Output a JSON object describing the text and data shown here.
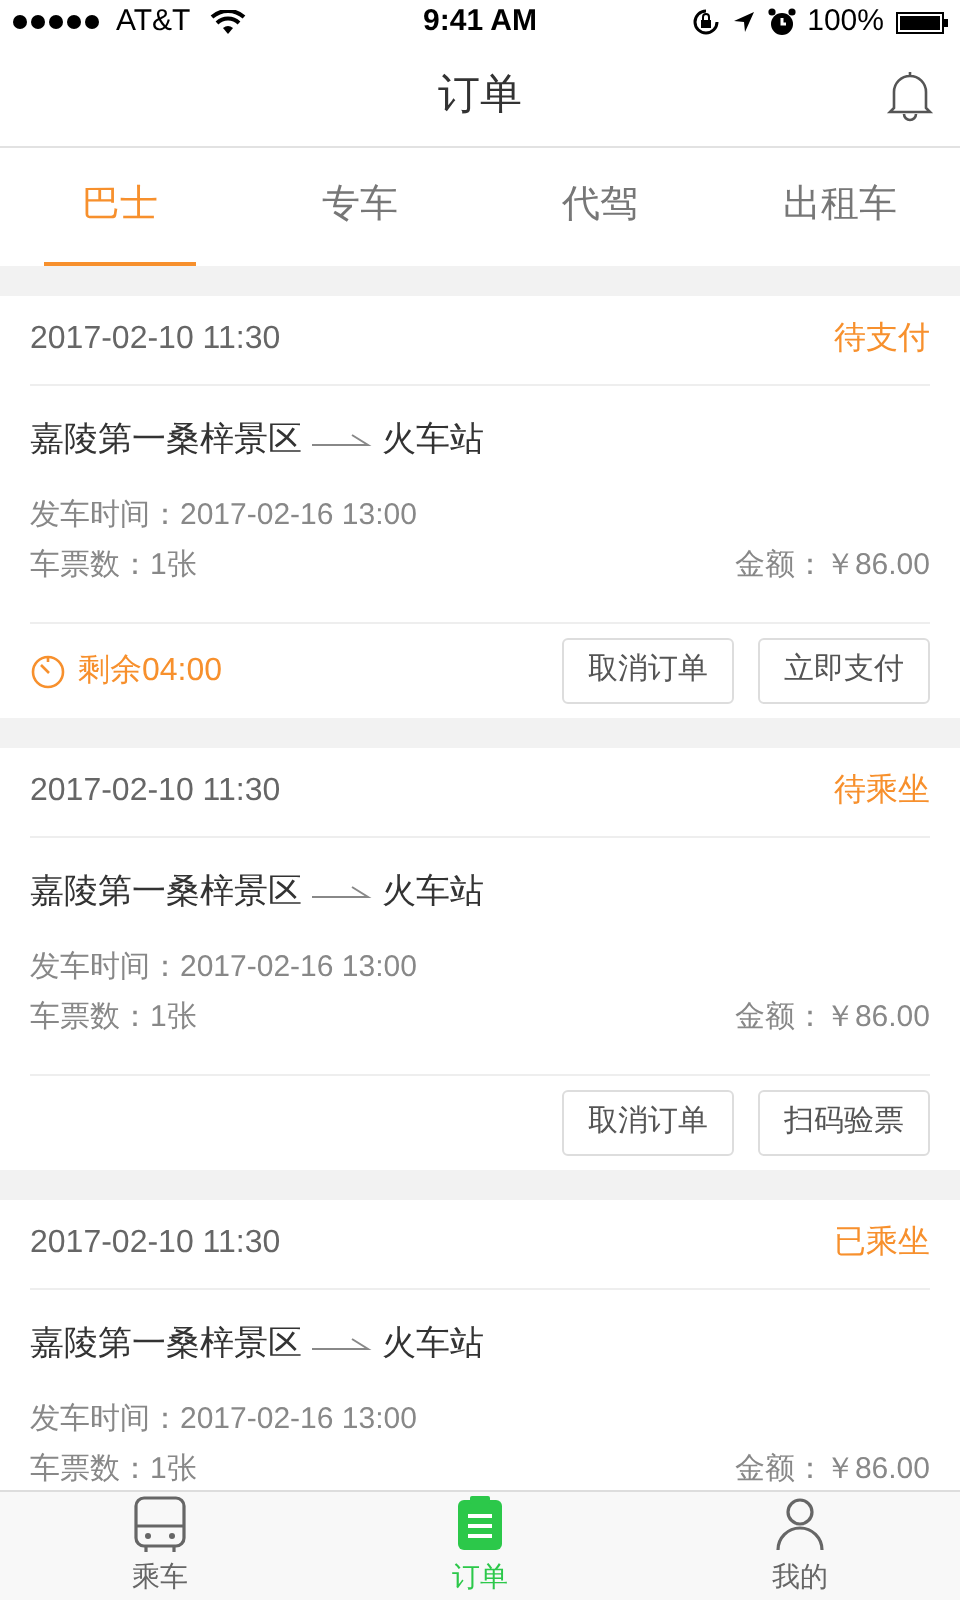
{
  "status_bar": {
    "carrier": "AT&T",
    "time": "9:41 AM",
    "battery": "100%"
  },
  "header": {
    "title": "订单"
  },
  "tabs": [
    {
      "label": "巴士",
      "selected": true
    },
    {
      "label": "专车",
      "selected": false
    },
    {
      "label": "代驾",
      "selected": false
    },
    {
      "label": "出租车",
      "selected": false
    }
  ],
  "orders": [
    {
      "created": "2017-02-10 11:30",
      "status": "待支付",
      "from": "嘉陵第一桑梓景区",
      "to": "火车站",
      "departure": "发车时间：2017-02-16 13:00",
      "tickets": "车票数：1张",
      "amount": "金额：￥86.00",
      "countdown": "剩余04:00",
      "buttons": [
        "取消订单",
        "立即支付"
      ]
    },
    {
      "created": "2017-02-10 11:30",
      "status": "待乘坐",
      "from": "嘉陵第一桑梓景区",
      "to": "火车站",
      "departure": "发车时间：2017-02-16 13:00",
      "tickets": "车票数：1张",
      "amount": "金额：￥86.00",
      "buttons": [
        "取消订单",
        "扫码验票"
      ]
    },
    {
      "created": "2017-02-10 11:30",
      "status": "已乘坐",
      "from": "嘉陵第一桑梓景区",
      "to": "火车站",
      "departure": "发车时间：2017-02-16 13:00",
      "tickets": "车票数：1张",
      "amount": "金额：￥86.00"
    }
  ],
  "bottom_nav": [
    {
      "label": "乘车",
      "kind": "bus",
      "selected": false
    },
    {
      "label": "订单",
      "kind": "orders",
      "selected": true
    },
    {
      "label": "我的",
      "kind": "profile",
      "selected": false
    }
  ]
}
